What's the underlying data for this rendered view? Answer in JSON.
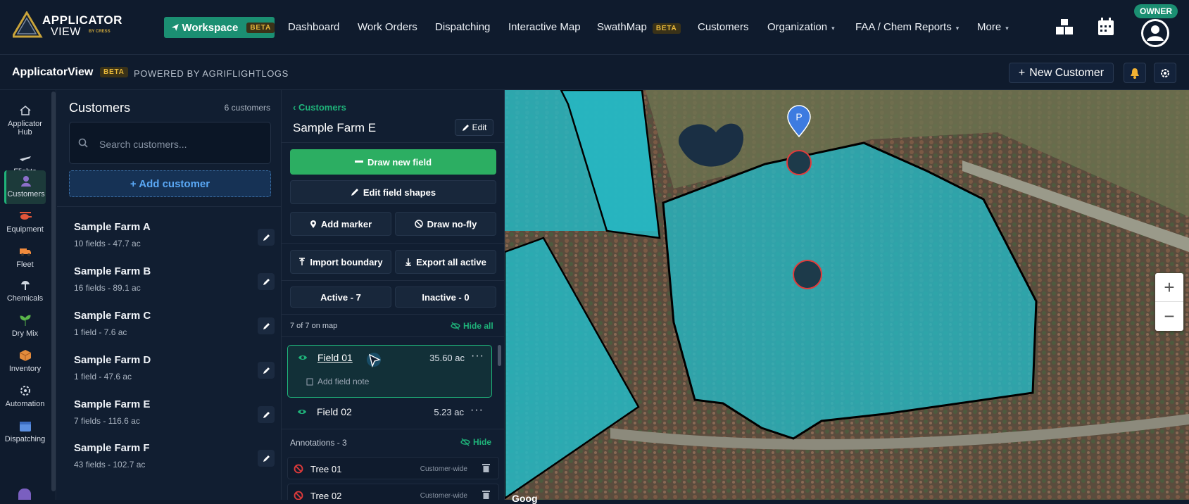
{
  "brand": {
    "logo_line1": "APPLICATOR",
    "logo_line2": "VIEW",
    "logo_by": "BY CRESS"
  },
  "topnav": {
    "workspace_label": "Workspace",
    "workspace_badge": "BETA",
    "items": [
      {
        "label": "Dashboard"
      },
      {
        "label": "Work Orders"
      },
      {
        "label": "Dispatching"
      },
      {
        "label": "Interactive Map"
      },
      {
        "label": "SwathMap",
        "badge": "BETA"
      },
      {
        "label": "Customers"
      },
      {
        "label": "Organization"
      },
      {
        "label": "FAA / Chem Reports"
      },
      {
        "label": "More"
      }
    ],
    "owner_badge": "OWNER"
  },
  "subbar": {
    "title": "ApplicatorView",
    "badge": "BETA",
    "powered": "POWERED BY AGRIFLIGHTLOGS",
    "new_customer": "New Customer"
  },
  "rail": [
    {
      "label": "Applicator Hub",
      "icon": "home-icon"
    },
    {
      "label": "Flights",
      "icon": "plane-icon"
    },
    {
      "label": "Customers",
      "icon": "user-icon",
      "active": true
    },
    {
      "label": "Equipment",
      "icon": "helicopter-icon"
    },
    {
      "label": "Fleet",
      "icon": "truck-icon"
    },
    {
      "label": "Chemicals",
      "icon": "spray-icon"
    },
    {
      "label": "Dry Mix",
      "icon": "sprout-icon"
    },
    {
      "label": "Inventory",
      "icon": "box-icon"
    },
    {
      "label": "Automation",
      "icon": "gear-icon"
    },
    {
      "label": "Dispatching",
      "icon": "calendar-icon"
    }
  ],
  "customers": {
    "title": "Customers",
    "count": "6 customers",
    "search_placeholder": "Search customers...",
    "add_label": "+ Add customer",
    "list": [
      {
        "name": "Sample Farm A",
        "meta": "10 fields - 47.7 ac"
      },
      {
        "name": "Sample Farm B",
        "meta": "16 fields - 89.1 ac"
      },
      {
        "name": "Sample Farm C",
        "meta": "1 field - 7.6 ac"
      },
      {
        "name": "Sample Farm D",
        "meta": "1 field - 47.6 ac"
      },
      {
        "name": "Sample Farm E",
        "meta": "7 fields - 116.6 ac"
      },
      {
        "name": "Sample Farm F",
        "meta": "43 fields - 102.7 ac"
      }
    ]
  },
  "fields": {
    "crumb": "‹ Customers",
    "title": "Sample Farm E",
    "edit": "Edit",
    "draw_new": "Draw new field",
    "edit_shapes": "Edit field shapes",
    "add_marker": "Add marker",
    "draw_nofly": "Draw no-fly",
    "import": "Import boundary",
    "export": "Export all active",
    "active": "Active - 7",
    "inactive": "Inactive - 0",
    "on_map": "7 of 7 on map",
    "hide_all": "Hide all",
    "rows": [
      {
        "name": "Field 01",
        "acres": "35.60 ac",
        "note": "Add field note"
      },
      {
        "name": "Field 02",
        "acres": "5.23 ac"
      }
    ],
    "annotations_label": "Annotations - 3",
    "annotations_hide": "Hide",
    "annotations": [
      {
        "name": "Tree 01",
        "scope": "Customer-wide"
      },
      {
        "name": "Tree 02",
        "scope": "Customer-wide"
      }
    ]
  },
  "map": {
    "marker_label": "P",
    "zoom_in": "+",
    "zoom_out": "−",
    "attribution": "Goog",
    "colors": {
      "field_fill": "#27b6c1",
      "boundary": "#000000",
      "hazard": "#e23b3b",
      "pin": "#3d7be0"
    }
  }
}
